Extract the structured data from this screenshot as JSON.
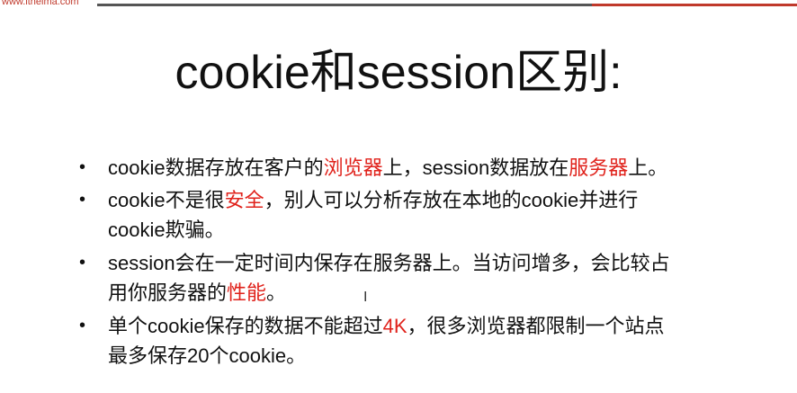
{
  "header": {
    "url": "www.itheima.com"
  },
  "slide": {
    "title": "cookie和session区别:",
    "bullets": [
      {
        "parts": [
          {
            "text": "cookie数据存放在客户的",
            "red": false
          },
          {
            "text": "浏览器",
            "red": true
          },
          {
            "text": "上，session数据放在",
            "red": false
          },
          {
            "text": "服务器",
            "red": true
          },
          {
            "text": "上。",
            "red": false
          }
        ]
      },
      {
        "parts": [
          {
            "text": "cookie不是很",
            "red": false
          },
          {
            "text": "安全",
            "red": true
          },
          {
            "text": "，别人可以分析存放在本地的cookie并进行",
            "red": false
          },
          {
            "text": "cookie欺骗。",
            "red": false
          }
        ]
      },
      {
        "parts": [
          {
            "text": "session会在一定时间内保存在服务器上。当访问增多，会比较占",
            "red": false
          },
          {
            "text": "用你服务器的",
            "red": false
          },
          {
            "text": "性能",
            "red": true
          },
          {
            "text": "。",
            "red": false
          }
        ]
      },
      {
        "parts": [
          {
            "text": "单个cookie保存的数据不能超过",
            "red": false
          },
          {
            "text": "4K",
            "red": true
          },
          {
            "text": "，很多浏览器都限制一个站点",
            "red": false
          },
          {
            "text": "最多保存20个cookie。",
            "red": false
          }
        ]
      }
    ],
    "bullet_symbol": "•",
    "cursor_symbol": "I",
    "accent_color": "#e0221b"
  }
}
